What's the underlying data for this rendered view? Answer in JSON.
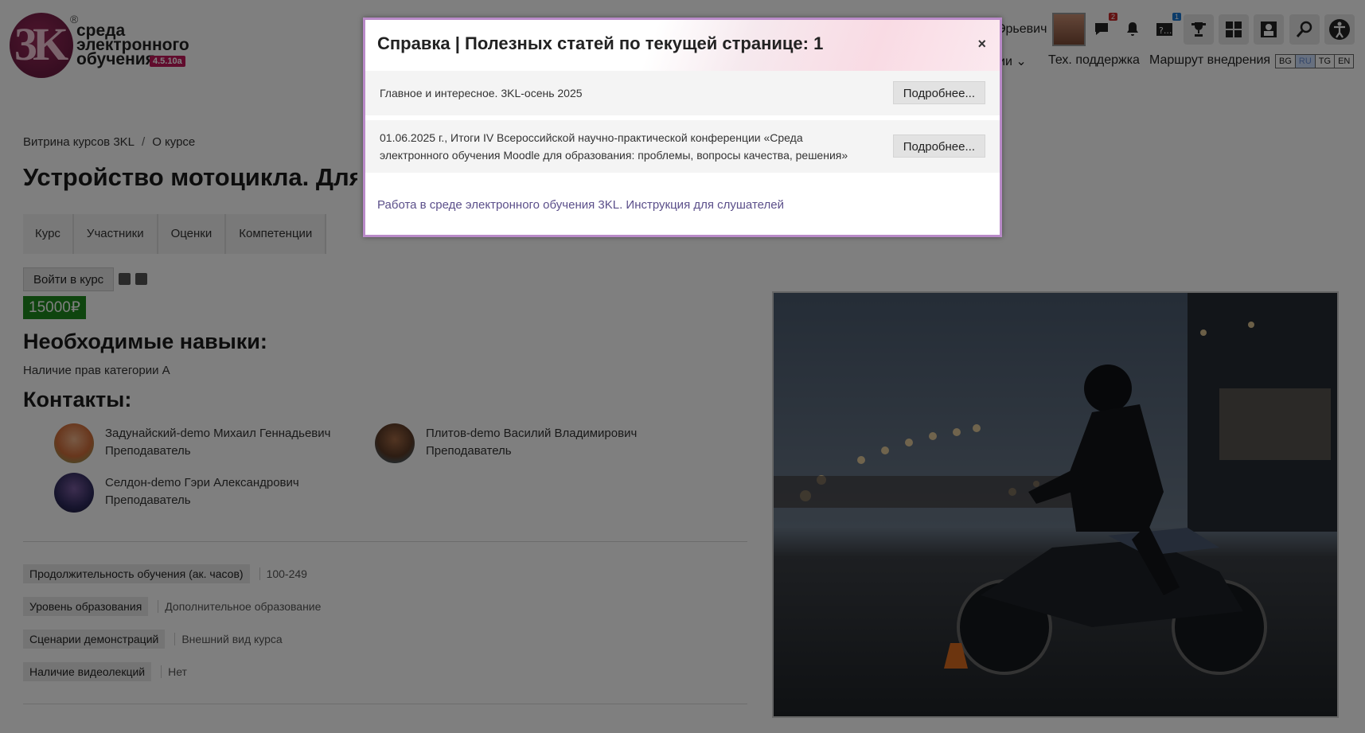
{
  "header": {
    "logo": {
      "line1": "среда",
      "line2": "электронного",
      "line3": "обучения",
      "version": "4.5.10a",
      "registered": "®",
      "mark": "3K"
    },
    "user_name": "Эрьевич",
    "icons": [
      {
        "name": "messages-icon",
        "badge": "2"
      },
      {
        "name": "bell-icon"
      },
      {
        "name": "help-counter-icon",
        "badge": "1"
      },
      {
        "name": "trophy-icon"
      },
      {
        "name": "dashboard-icon"
      },
      {
        "name": "user-switch-icon"
      },
      {
        "name": "search-icon"
      },
      {
        "name": "accessibility-icon"
      }
    ],
    "nav": {
      "partial_item": "ии",
      "support": "Тех. поддержка",
      "route": "Маршрут внедрения"
    },
    "languages": [
      "BG",
      "RU",
      "TG",
      "EN"
    ],
    "active_language": "RU"
  },
  "breadcrumb": {
    "items": [
      "Витрина курсов 3KL",
      "О курсе"
    ],
    "separator": "/"
  },
  "page_title": "Устройство мотоцикла. Для де",
  "tabs": [
    "Курс",
    "Участники",
    "Оценки",
    "Компетенции"
  ],
  "enroll_label": "Войти в курс",
  "price": "15000₽",
  "skills": {
    "heading": "Необходимые навыки:",
    "text": "Наличие прав категории А"
  },
  "contacts": {
    "heading": "Контакты:",
    "items": [
      {
        "name": "Задунайский-demo Михаил Геннадьевич",
        "role": "Преподаватель"
      },
      {
        "name": "Плитов-demo Василий Владимирович",
        "role": "Преподаватель"
      },
      {
        "name": "Селдон-demo Гэри Александрович",
        "role": "Преподаватель"
      }
    ]
  },
  "properties": [
    {
      "key": "Продолжительность обучения (ак. часов)",
      "value": "100-249"
    },
    {
      "key": "Уровень образования",
      "value": "Дополнительное образование"
    },
    {
      "key": "Сценарии демонстраций",
      "value": "Внешний вид курса"
    },
    {
      "key": "Наличие видеолекций",
      "value": "Нет"
    }
  ],
  "modal": {
    "title": "Справка | Полезных статей по текущей странице: 1",
    "close": "×",
    "articles": [
      {
        "text": "Главное и интересное. 3KL-осень 2025",
        "button": "Подробнее..."
      },
      {
        "text_line1": "01.06.2025 г., Итоги IV Всероссийской научно-практической конференции «Среда",
        "text_line2": "электронного обучения Moodle для образования: проблемы, вопросы качества, решения»",
        "button": "Подробнее..."
      }
    ],
    "link": "Работа в среде электронного обучения 3KL. Инструкция для слушателей"
  },
  "colors": {
    "price_badge": "#1e8a1e",
    "modal_border": "#b98ac8",
    "logo_accent": "#c2185b",
    "modal_link": "#5b4f8a"
  }
}
